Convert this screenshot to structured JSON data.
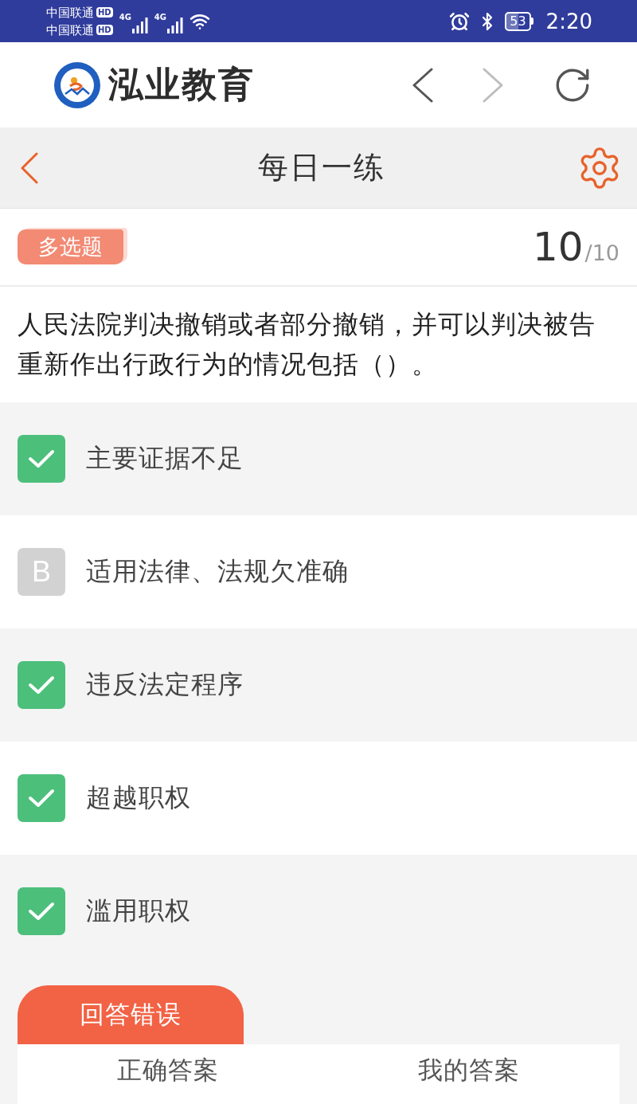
{
  "status_bar": {
    "carriers": [
      {
        "name": "中国联通",
        "badge": "HD"
      },
      {
        "name": "中国联通",
        "badge": "HD"
      }
    ],
    "networks": [
      "4G",
      "4G"
    ],
    "battery": "53",
    "time": "2:20"
  },
  "browser_bar": {
    "site_name": "泓业教育",
    "buttons": [
      {
        "kind": "back",
        "disabled": false
      },
      {
        "kind": "forward",
        "disabled": true
      },
      {
        "kind": "reload",
        "disabled": false
      }
    ]
  },
  "nav": {
    "title": "每日一练"
  },
  "question": {
    "type": "多选题",
    "number": "10",
    "total": "/10",
    "text": "人民法院判决撤销或者部分撤销，并可以判决被告重新作出行政行为的情况包括（）。"
  },
  "options": [
    {
      "text": "主要证据不足",
      "checked": true
    },
    {
      "letter": "B",
      "text": "适用法律、法规欠准确",
      "checked": false
    },
    {
      "text": "违反法定程序",
      "checked": true
    },
    {
      "text": "超越职权",
      "checked": true
    },
    {
      "text": "滥用职权",
      "checked": true
    }
  ],
  "result": {
    "label": "回答错误",
    "correct": false,
    "columns": [
      "正确答案",
      "我的答案"
    ]
  }
}
